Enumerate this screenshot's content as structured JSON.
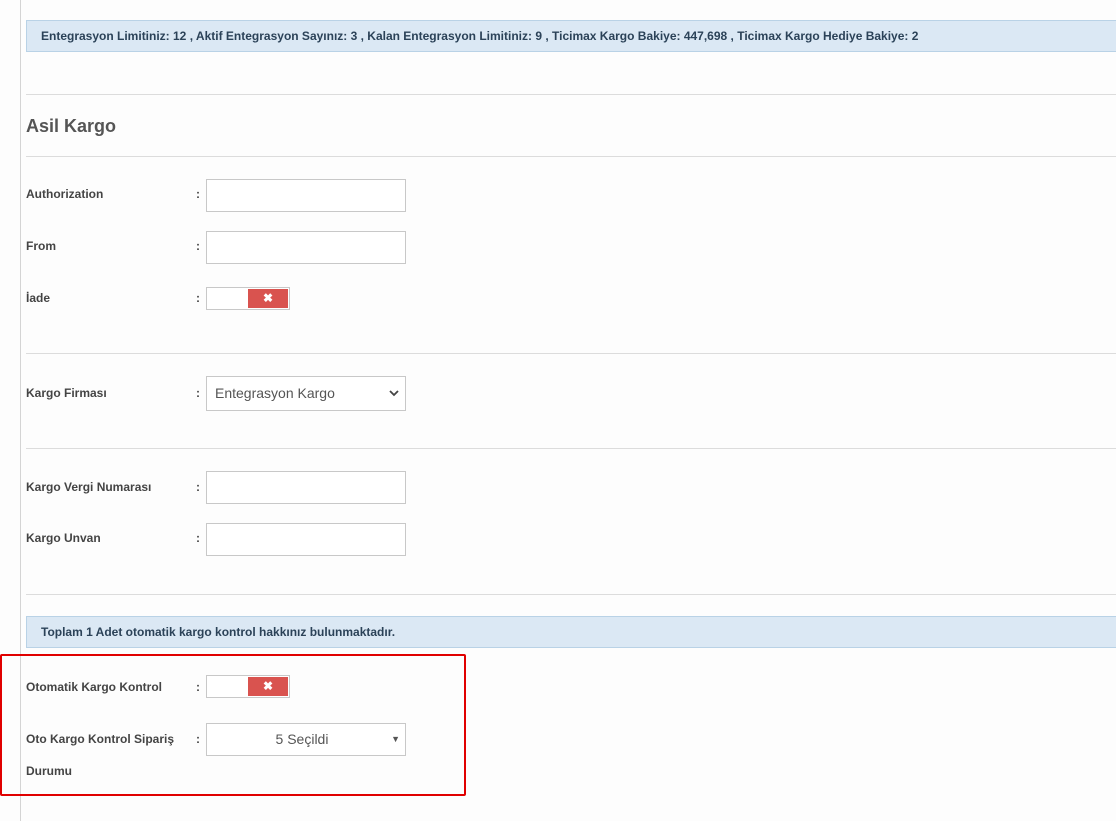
{
  "info_bar": {
    "text": "Entegrasyon Limitiniz: 12 , Aktif Entegrasyon Sayınız: 3 , Kalan Entegrasyon Limitiniz: 9 , Ticimax Kargo Bakiye: 447,698 , Ticimax Kargo Hediye Bakiye: 2"
  },
  "section": {
    "title": "Asil Kargo"
  },
  "colon": ":",
  "fields": {
    "authorization": {
      "label": "Authorization",
      "value": "",
      "placeholder": ""
    },
    "from": {
      "label": "From",
      "value": "",
      "placeholder": ""
    },
    "iade": {
      "label": "İade",
      "state": "off",
      "glyph": "✖"
    },
    "kargo_firmasi": {
      "label": "Kargo Firması",
      "selected": "Entegrasyon Kargo"
    },
    "kargo_vergi_numarasi": {
      "label": "Kargo Vergi Numarası",
      "value": "",
      "placeholder": ""
    },
    "kargo_unvan": {
      "label": "Kargo Unvan",
      "value": "",
      "placeholder": ""
    }
  },
  "auto_check_notice": {
    "text": "Toplam 1 Adet otomatik kargo kontrol hakkınız bulunmaktadır."
  },
  "auto_check": {
    "otomatik_kargo_kontrol": {
      "label": "Otomatik Kargo Kontrol",
      "state": "off",
      "glyph": "✖"
    },
    "oto_kargo_kontrol_siparis_durumu": {
      "label_line1": "Oto Kargo Kontrol Sipariş",
      "label_line2": "Durumu",
      "selected": "5 Seçildi",
      "caret": "▼"
    }
  },
  "colors": {
    "info_bar_bg": "#dbe8f4",
    "toggle_off": "#d9534f",
    "highlight": "#e00000"
  }
}
